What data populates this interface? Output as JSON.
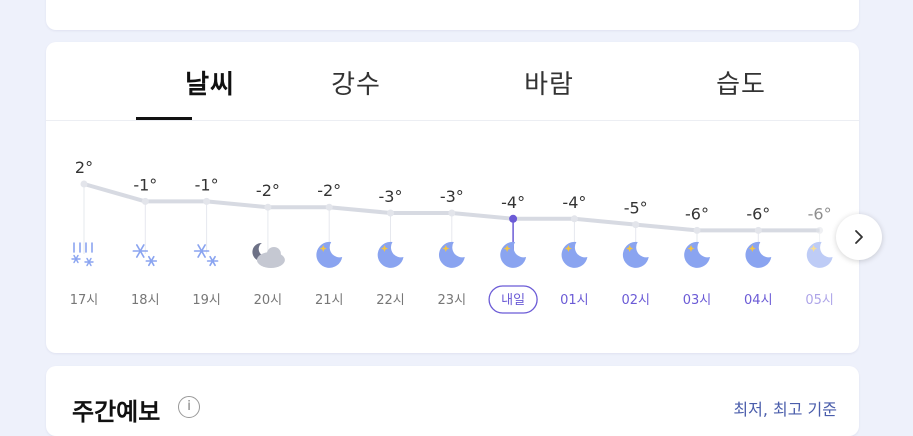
{
  "tabs": [
    {
      "label": "날씨",
      "active": true
    },
    {
      "label": "강수",
      "active": false
    },
    {
      "label": "바람",
      "active": false
    },
    {
      "label": "습도",
      "active": false
    }
  ],
  "hourly": [
    {
      "time": "17시",
      "temp": "2°",
      "value": 2,
      "icon": "rain-snow-icon",
      "night": false
    },
    {
      "time": "18시",
      "temp": "-1°",
      "value": -1,
      "icon": "snow-icon",
      "night": false
    },
    {
      "time": "19시",
      "temp": "-1°",
      "value": -1,
      "icon": "snow-icon",
      "night": false
    },
    {
      "time": "20시",
      "temp": "-2°",
      "value": -2,
      "icon": "cloudy-night-icon",
      "night": false
    },
    {
      "time": "21시",
      "temp": "-2°",
      "value": -2,
      "icon": "moon-icon",
      "night": false
    },
    {
      "time": "22시",
      "temp": "-3°",
      "value": -3,
      "icon": "moon-icon",
      "night": false
    },
    {
      "time": "23시",
      "temp": "-3°",
      "value": -3,
      "icon": "moon-icon",
      "night": false
    },
    {
      "time": "내일",
      "temp": "-4°",
      "value": -4,
      "icon": "moon-icon",
      "night": true,
      "highlight": true
    },
    {
      "time": "01시",
      "temp": "-4°",
      "value": -4,
      "icon": "moon-icon",
      "night": true
    },
    {
      "time": "02시",
      "temp": "-5°",
      "value": -5,
      "icon": "moon-icon",
      "night": true
    },
    {
      "time": "03시",
      "temp": "-6°",
      "value": -6,
      "icon": "moon-icon",
      "night": true
    },
    {
      "time": "04시",
      "temp": "-6°",
      "value": -6,
      "icon": "moon-icon",
      "night": true
    },
    {
      "time": "05시",
      "temp": "-6°",
      "value": -6,
      "icon": "moon-icon",
      "night": true,
      "faded": true
    }
  ],
  "colors": {
    "accent": "#6b5bd6",
    "line": "#d7dae2",
    "moon": "#8aa4f0",
    "star": "#f4c542"
  },
  "next_section": {
    "title": "주간예보",
    "link": "최저, 최고 기준"
  }
}
